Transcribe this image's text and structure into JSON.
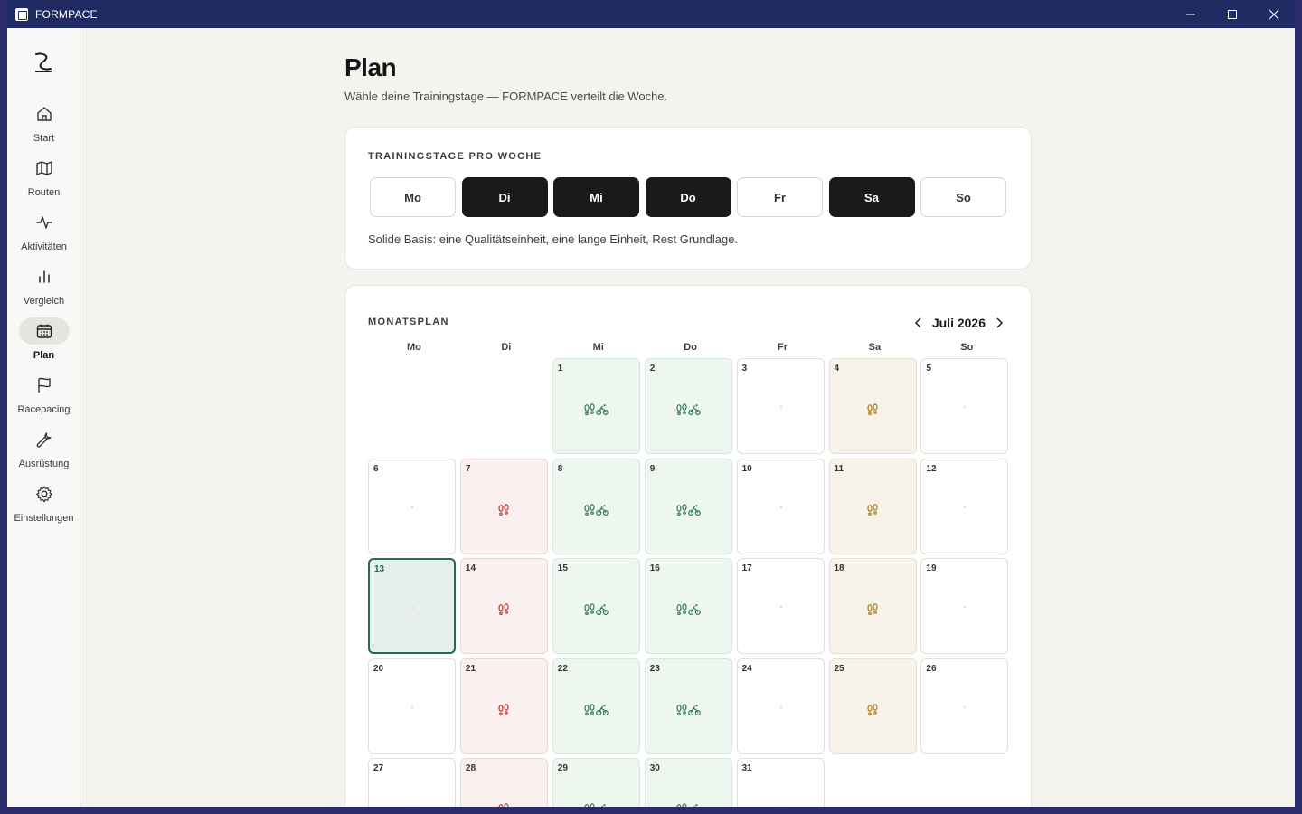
{
  "window": {
    "title": "FORMPACE"
  },
  "sidebar": {
    "items": [
      {
        "label": "Start",
        "icon": "home-icon"
      },
      {
        "label": "Routen",
        "icon": "map-icon"
      },
      {
        "label": "Aktivitäten",
        "icon": "activity-icon"
      },
      {
        "label": "Vergleich",
        "icon": "bar-chart-icon"
      },
      {
        "label": "Plan",
        "icon": "calendar-icon",
        "active": true
      },
      {
        "label": "Racepacing",
        "icon": "flag-icon"
      },
      {
        "label": "Ausrüstung",
        "icon": "wrench-icon"
      },
      {
        "label": "Einstellungen",
        "icon": "gear-icon"
      }
    ]
  },
  "page": {
    "title": "Plan",
    "subtitle": "Wähle deine Trainingstage — FORMPACE verteilt die Woche."
  },
  "training_days": {
    "label": "TRAININGSTAGE PRO WOCHE",
    "days": [
      {
        "label": "Mo",
        "selected": false
      },
      {
        "label": "Di",
        "selected": true
      },
      {
        "label": "Mi",
        "selected": true
      },
      {
        "label": "Do",
        "selected": true
      },
      {
        "label": "Fr",
        "selected": false
      },
      {
        "label": "Sa",
        "selected": true
      },
      {
        "label": "So",
        "selected": false
      }
    ],
    "note": "Solide Basis: eine Qualitätseinheit, eine lange Einheit, Rest Grundlage."
  },
  "month_plan": {
    "label": "MONATSPLAN",
    "month": "Juli 2026",
    "weekdays": [
      "Mo",
      "Di",
      "Mi",
      "Do",
      "Fr",
      "Sa",
      "So"
    ],
    "colors": {
      "green": "#2f7a52",
      "red": "#c0392b",
      "tan": "#b07d12",
      "today": "#1e6a5b"
    },
    "weeks": [
      [
        null,
        null,
        {
          "d": "1",
          "t": "green"
        },
        {
          "d": "2",
          "t": "green"
        },
        {
          "d": "3",
          "t": "rest"
        },
        {
          "d": "4",
          "t": "tan"
        },
        {
          "d": "5",
          "t": "rest"
        }
      ],
      [
        {
          "d": "6",
          "t": "rest"
        },
        {
          "d": "7",
          "t": "red"
        },
        {
          "d": "8",
          "t": "green"
        },
        {
          "d": "9",
          "t": "green"
        },
        {
          "d": "10",
          "t": "rest"
        },
        {
          "d": "11",
          "t": "tan"
        },
        {
          "d": "12",
          "t": "rest"
        }
      ],
      [
        {
          "d": "13",
          "t": "today"
        },
        {
          "d": "14",
          "t": "red"
        },
        {
          "d": "15",
          "t": "green"
        },
        {
          "d": "16",
          "t": "green"
        },
        {
          "d": "17",
          "t": "rest"
        },
        {
          "d": "18",
          "t": "tan"
        },
        {
          "d": "19",
          "t": "rest"
        }
      ],
      [
        {
          "d": "20",
          "t": "rest"
        },
        {
          "d": "21",
          "t": "red"
        },
        {
          "d": "22",
          "t": "green"
        },
        {
          "d": "23",
          "t": "green"
        },
        {
          "d": "24",
          "t": "rest"
        },
        {
          "d": "25",
          "t": "tan"
        },
        {
          "d": "26",
          "t": "rest"
        }
      ],
      [
        {
          "d": "27",
          "t": "rest"
        },
        {
          "d": "28",
          "t": "red"
        },
        {
          "d": "29",
          "t": "green"
        },
        {
          "d": "30",
          "t": "green"
        },
        {
          "d": "31",
          "t": "rest"
        },
        null,
        null
      ]
    ]
  }
}
